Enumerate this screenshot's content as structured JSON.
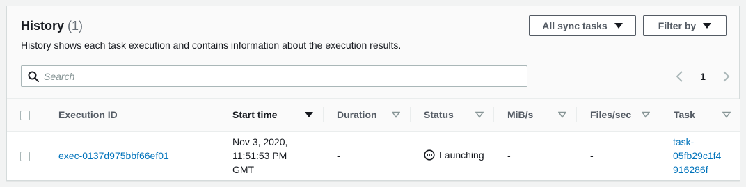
{
  "header": {
    "title": "History",
    "count": "(1)",
    "description": "History shows each task execution and contains information about the execution results.",
    "sync_tasks_label": "All sync tasks",
    "filter_label": "Filter by"
  },
  "search": {
    "placeholder": "Search",
    "value": ""
  },
  "pagination": {
    "current_page": "1"
  },
  "table": {
    "columns": {
      "execution_id": "Execution ID",
      "start_time": "Start time",
      "duration": "Duration",
      "status": "Status",
      "mibs": "MiB/s",
      "files_sec": "Files/sec",
      "task": "Task"
    },
    "rows": [
      {
        "execution_id": "exec-0137d975bbf66ef01",
        "start_line1": "Nov 3, 2020,",
        "start_line2": "11:51:53 PM",
        "start_line3": "GMT",
        "duration": "-",
        "status": "Launching",
        "mibs": "-",
        "files_sec": "-",
        "task_line1": "task-",
        "task_line2": "05fb29c1f4",
        "task_line3": "916286f"
      }
    ]
  },
  "icons": [
    "search-icon",
    "caret-down-icon",
    "chevron-left-icon",
    "chevron-right-icon",
    "sort-down-icon",
    "sort-filled-icon",
    "status-pending-icon"
  ],
  "colors": {
    "link": "#0073bb",
    "border": "#545b64",
    "muted": "#879596"
  }
}
